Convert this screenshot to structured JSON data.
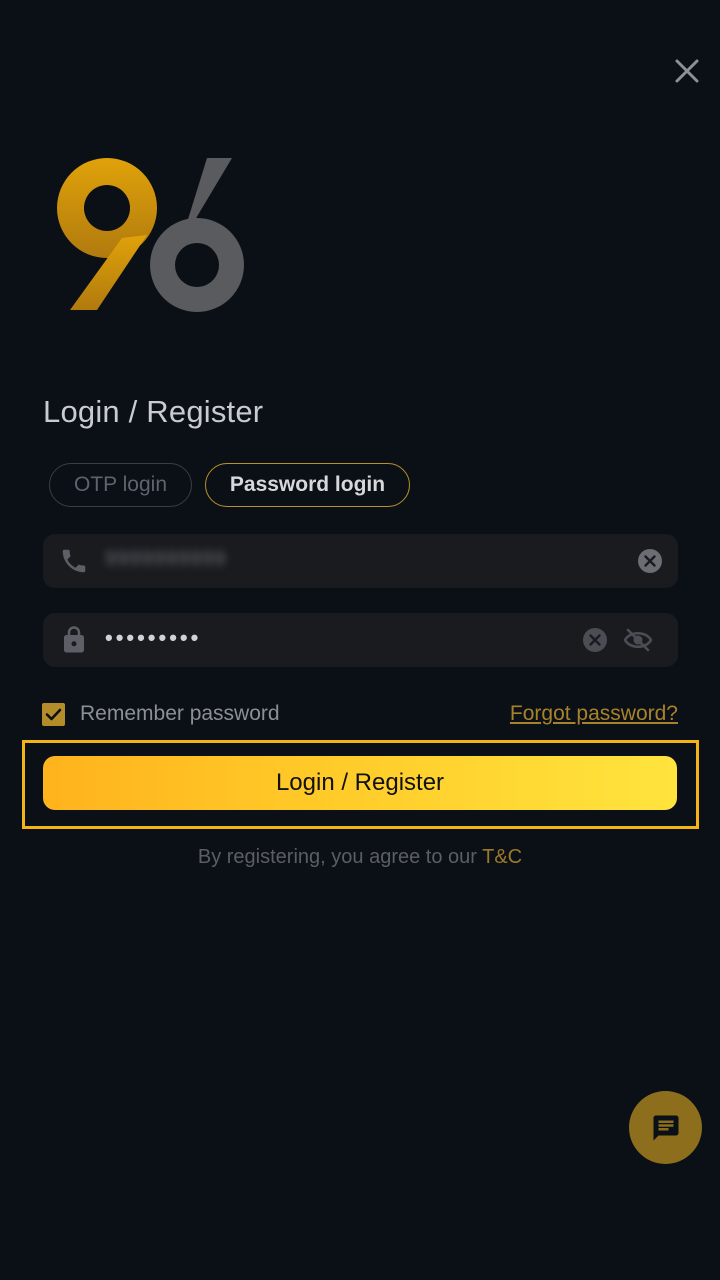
{
  "header": {
    "close_icon": "close-icon"
  },
  "logo": {
    "text": "96",
    "colors": {
      "nine": "#c88a0c",
      "six": "#5a5b5e"
    }
  },
  "heading": "Login / Register",
  "tabs": [
    {
      "label": "OTP login",
      "active": false
    },
    {
      "label": "Password login",
      "active": true
    }
  ],
  "phone_field": {
    "icon": "phone-icon",
    "value": "9999999999",
    "clear_icon": "clear-icon"
  },
  "password_field": {
    "icon": "lock-icon",
    "value": "•••••••••",
    "clear_icon": "clear-icon",
    "visibility_icon": "eye-off-icon"
  },
  "remember": {
    "label": "Remember password",
    "checked": true
  },
  "forgot": {
    "label": "Forgot password? "
  },
  "login_button": {
    "label": "Login / Register"
  },
  "terms": {
    "prefix": "By registering, you agree to our ",
    "link": "T&C"
  },
  "chat": {
    "icon": "chat-icon"
  },
  "colors": {
    "background": "#0b0f16",
    "accent": "#f5b416",
    "button_gradient_start": "#ffb31d",
    "button_gradient_end": "#ffe43d"
  }
}
